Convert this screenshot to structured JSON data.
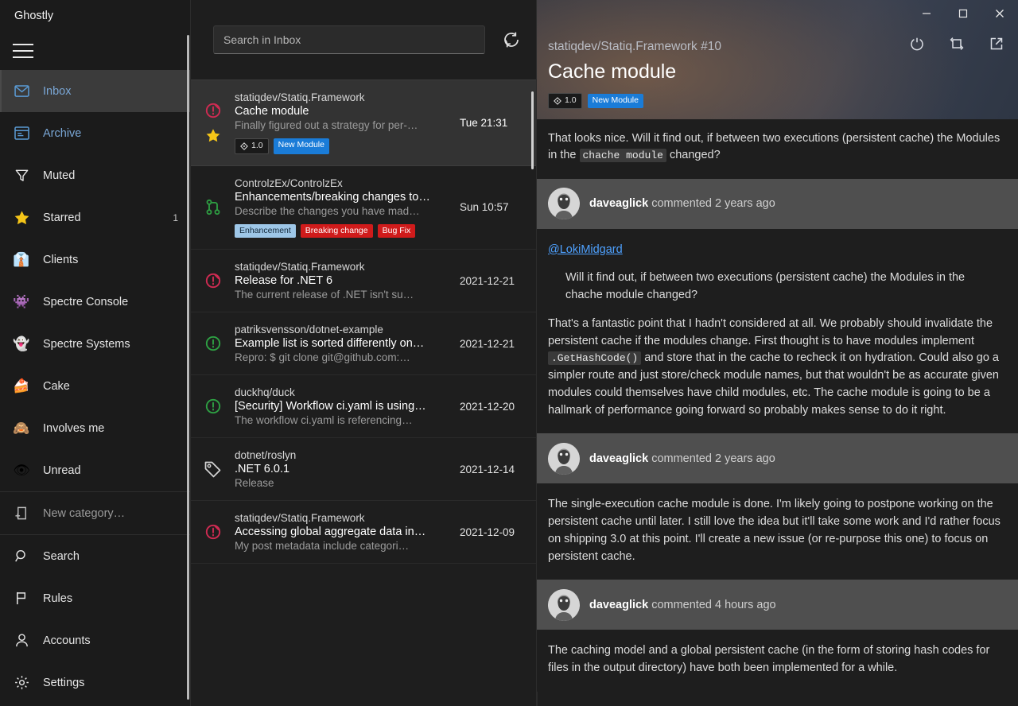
{
  "app": {
    "title": "Ghostly"
  },
  "window_controls": [
    {
      "name": "minimize",
      "glyph": "minimize-icon"
    },
    {
      "name": "maximize",
      "glyph": "maximize-icon"
    },
    {
      "name": "close",
      "glyph": "close-icon"
    }
  ],
  "action_controls": [
    {
      "name": "refresh",
      "glyph": "refresh-icon"
    },
    {
      "name": "mark-read",
      "glyph": "mark-read-icon"
    },
    {
      "name": "open-external",
      "glyph": "open-external-icon"
    }
  ],
  "sidebar": {
    "menu_label": "Menu",
    "items": [
      {
        "label": "Inbox",
        "icon": "envelope-icon",
        "emoji": "",
        "count": "",
        "active": true,
        "accent": true
      },
      {
        "label": "Archive",
        "icon": "archive-icon",
        "emoji": "",
        "count": "",
        "active": false,
        "accent": true
      },
      {
        "label": "Muted",
        "icon": "funnel-icon",
        "emoji": "",
        "count": "",
        "active": false,
        "accent": false
      },
      {
        "label": "Starred",
        "icon": "star-icon",
        "emoji": "⭐",
        "count": "1",
        "active": false,
        "accent": false
      },
      {
        "label": "Clients",
        "icon": "necktie-icon",
        "emoji": "👔",
        "count": "",
        "active": false,
        "accent": false
      },
      {
        "label": "Spectre Console",
        "icon": "alien-monster-icon",
        "emoji": "👾",
        "count": "",
        "active": false,
        "accent": false
      },
      {
        "label": "Spectre Systems",
        "icon": "ghost-icon",
        "emoji": "👻",
        "count": "",
        "active": false,
        "accent": false
      },
      {
        "label": "Cake",
        "icon": "cake-slice-icon",
        "emoji": "🍰",
        "count": "",
        "active": false,
        "accent": false
      },
      {
        "label": "Involves me",
        "icon": "see-no-evil-icon",
        "emoji": "🙈",
        "count": "",
        "active": false,
        "accent": false
      },
      {
        "label": "Unread",
        "icon": "eye-icon",
        "emoji": "👁",
        "count": "",
        "active": false,
        "accent": false
      }
    ],
    "new_category": {
      "label": "New category…",
      "icon": "new-category-icon"
    },
    "footer_items": [
      {
        "label": "Search",
        "icon": "search-icon"
      },
      {
        "label": "Rules",
        "icon": "flag-icon"
      },
      {
        "label": "Accounts",
        "icon": "person-icon"
      },
      {
        "label": "Settings",
        "icon": "gear-icon"
      }
    ]
  },
  "list": {
    "search": {
      "placeholder": "Search in Inbox",
      "value": ""
    },
    "refresh_label": "Refresh",
    "messages": [
      {
        "repo": "statiqdev/Statiq.Framework",
        "title": "Cache module",
        "snippet": "Finally figured out a strategy for per-…",
        "date": "Tue 21:31",
        "type_icon": "issue-closed-icon",
        "starred": true,
        "selected": true,
        "tags": [
          {
            "text": "1.0",
            "kind": "milestone",
            "bg": "#1a1a1a",
            "fg": "#e0e0e0"
          },
          {
            "text": "New Module",
            "kind": "label",
            "bg": "#1a7cd8",
            "fg": "#ffffff"
          }
        ]
      },
      {
        "repo": "ControlzEx/ControlzEx",
        "title": "Enhancements/breaking changes to…",
        "snippet": "Describe the changes you have mad…",
        "date": "Sun 10:57",
        "type_icon": "pull-request-icon",
        "starred": false,
        "selected": false,
        "tags": [
          {
            "text": "Enhancement",
            "kind": "label",
            "bg": "#9ec7e8",
            "fg": "#12283a"
          },
          {
            "text": "Breaking change",
            "kind": "label",
            "bg": "#d01b1b",
            "fg": "#ffffff"
          },
          {
            "text": "Bug Fix",
            "kind": "label",
            "bg": "#d01b1b",
            "fg": "#ffffff"
          }
        ]
      },
      {
        "repo": "statiqdev/Statiq.Framework",
        "title": "Release for .NET 6",
        "snippet": "The current release of .NET isn't su…",
        "date": "2021-12-21",
        "type_icon": "issue-closed-icon",
        "starred": false,
        "selected": false,
        "tags": []
      },
      {
        "repo": "patriksvensson/dotnet-example",
        "title": "Example list is sorted differently on…",
        "snippet": "Repro: $ git clone git@github.com:…",
        "date": "2021-12-21",
        "type_icon": "issue-open-icon",
        "starred": false,
        "selected": false,
        "tags": []
      },
      {
        "repo": "duckhq/duck",
        "title": "[Security] Workflow ci.yaml is using…",
        "snippet": "The workflow ci.yaml is referencing…",
        "date": "2021-12-20",
        "type_icon": "issue-open-icon",
        "starred": false,
        "selected": false,
        "tags": []
      },
      {
        "repo": "dotnet/roslyn",
        "title": ".NET 6.0.1",
        "snippet": "Release",
        "date": "2021-12-14",
        "type_icon": "tag-icon",
        "starred": false,
        "selected": false,
        "tags": []
      },
      {
        "repo": "statiqdev/Statiq.Framework",
        "title": "Accessing global aggregate data in…",
        "snippet": "My post metadata include categori…",
        "date": "2021-12-09",
        "type_icon": "issue-closed-icon",
        "starred": false,
        "selected": false,
        "tags": []
      }
    ]
  },
  "detail": {
    "repo": "statiqdev/Statiq.Framework #10",
    "title": "Cache module",
    "tags": [
      {
        "text": "1.0",
        "kind": "milestone",
        "bg": "#1a1a1a",
        "fg": "#e0e0e0"
      },
      {
        "text": "New Module",
        "kind": "label",
        "bg": "#1a7cd8",
        "fg": "#ffffff"
      }
    ],
    "intro": {
      "part1": "That looks nice. Will it find out, if between two executions (persistent cache) the Modules in the ",
      "code": "chache module",
      "part2": " changed?"
    },
    "comments": [
      {
        "author": "daveaglick",
        "meta": "commented 2 years ago",
        "mention": "@LokiMidgard",
        "quote": "Will it find out, if between two executions (persistent cache) the Modules in the chache module changed?",
        "body_part1": "That's a fantastic point that I hadn't considered at all. We probably should invalidate the persistent cache if the modules change. First thought is to have modules implement ",
        "body_code": ".GetHashCode()",
        "body_part2": " and store that in the cache to recheck it on hydration. Could also go a simpler route and just store/check module names, but that wouldn't be as accurate given modules could themselves have child modules, etc. The cache module is going to be a hallmark of performance going forward so probably makes sense to do it right."
      },
      {
        "author": "daveaglick",
        "meta": "commented 2 years ago",
        "body": "The single-execution cache module is done. I'm likely going to postpone working on the persistent cache until later. I still love the idea but it'll take some work and I'd rather focus on shipping 3.0 at this point. I'll create a new issue (or re-purpose this one) to focus on persistent cache."
      },
      {
        "author": "daveaglick",
        "meta": "commented 4 hours ago",
        "body": "The caching model and a global persistent cache (in the form of storing hash codes for files in the output directory) have both been implemented for a while."
      }
    ]
  },
  "colors": {
    "accent": "#1a7cd8",
    "sidebar_bg": "#1b1b1b",
    "list_bg": "#1e1e1e",
    "selected_bg": "#333333",
    "comment_header_bg": "#4f4f4f",
    "issue_closed": "#cf2b52",
    "issue_open": "#2ea043",
    "pull_request": "#2ea043",
    "star": "#ffc83d"
  }
}
